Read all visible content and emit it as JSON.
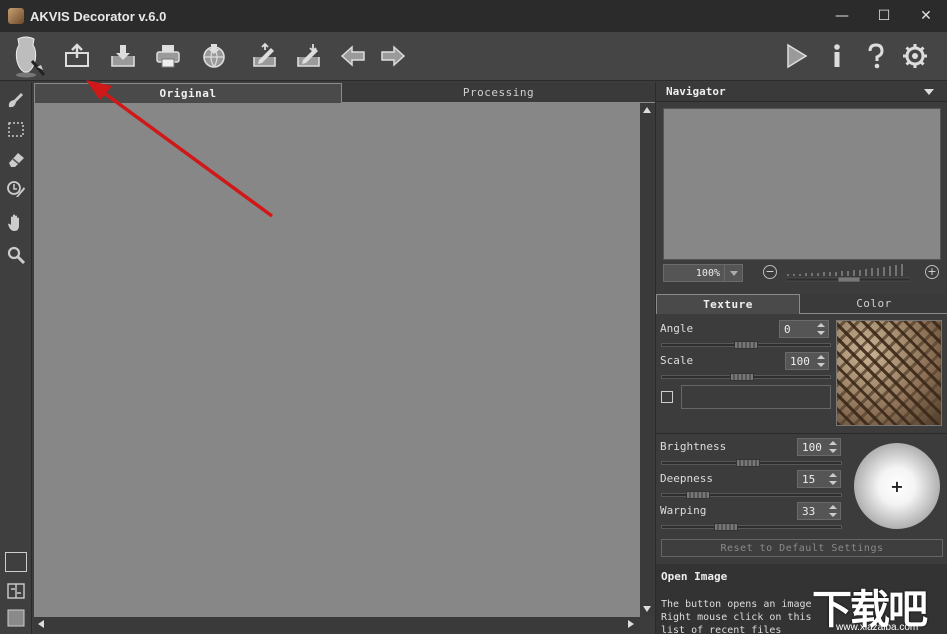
{
  "window": {
    "title": "AKVIS Decorator v.6.0",
    "controls": {
      "minimize": "—",
      "maximize": "☐",
      "close": "✕"
    }
  },
  "toolbar": {
    "buttons": [
      {
        "name": "open-image-icon"
      },
      {
        "name": "save-image-icon"
      },
      {
        "name": "print-icon"
      },
      {
        "name": "share-icon"
      },
      {
        "name": "import-preset-icon"
      },
      {
        "name": "export-preset-icon"
      },
      {
        "name": "undo-arrow-icon"
      },
      {
        "name": "redo-arrow-icon"
      }
    ],
    "right": [
      {
        "name": "run-play-icon"
      },
      {
        "name": "info-icon"
      },
      {
        "name": "help-icon"
      },
      {
        "name": "settings-gear-icon"
      }
    ]
  },
  "canvas": {
    "tabs": [
      {
        "label": "Original",
        "active": true
      },
      {
        "label": "Processing",
        "active": false
      }
    ]
  },
  "navigator": {
    "title": "Navigator",
    "zoom": "100%"
  },
  "params": {
    "tabs": [
      {
        "label": "Texture",
        "active": true
      },
      {
        "label": "Color",
        "active": false
      }
    ],
    "angle": {
      "label": "Angle",
      "value": "0"
    },
    "scale": {
      "label": "Scale",
      "value": "100"
    },
    "brightness": {
      "label": "Brightness",
      "value": "100"
    },
    "deepness": {
      "label": "Deepness",
      "value": "15"
    },
    "warping": {
      "label": "Warping",
      "value": "33"
    },
    "light_marker": "+",
    "reset_label": "Reset to Default Settings"
  },
  "help": {
    "title": "Open Image",
    "lines": [
      "The button opens an image",
      "Right mouse click on this",
      "list of recent files"
    ]
  },
  "watermark": {
    "main": "下载吧",
    "url": "www.xiazaiba.com"
  }
}
